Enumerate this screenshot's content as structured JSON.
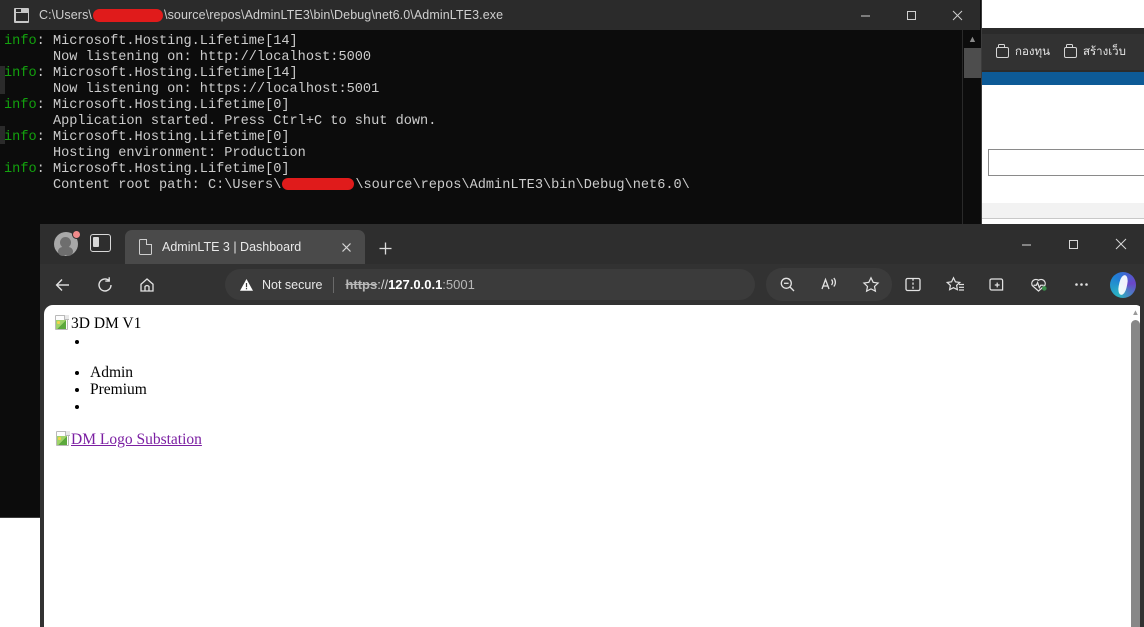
{
  "background_window": {
    "name": "background-browser-window",
    "bookmarks": [
      {
        "label": "กองทุน",
        "icon": "folder-icon"
      },
      {
        "label": "สร้างเว็บ",
        "icon": "folder-icon"
      }
    ],
    "accent_color": "#0d5a96"
  },
  "console": {
    "title_prefix": "C:\\Users\\",
    "title_suffix": "\\source\\repos\\AdminLTE3\\bin\\Debug\\net6.0\\AdminLTE3.exe",
    "icon": "console-window-icon",
    "window_buttons": {
      "minimize": "minimize-icon",
      "maximize": "maximize-icon",
      "close": "close-icon"
    },
    "lines": [
      {
        "level": "info",
        "sep": ": ",
        "text": "Microsoft.Hosting.Lifetime[14]"
      },
      {
        "level": "",
        "sep": "",
        "text": "      Now listening on: http://localhost:5000"
      },
      {
        "level": "info",
        "sep": ": ",
        "text": "Microsoft.Hosting.Lifetime[14]"
      },
      {
        "level": "",
        "sep": "",
        "text": "      Now listening on: https://localhost:5001"
      },
      {
        "level": "info",
        "sep": ": ",
        "text": "Microsoft.Hosting.Lifetime[0]"
      },
      {
        "level": "",
        "sep": "",
        "text": "      Application started. Press Ctrl+C to shut down."
      },
      {
        "level": "info",
        "sep": ": ",
        "text": "Microsoft.Hosting.Lifetime[0]"
      },
      {
        "level": "",
        "sep": "",
        "text": "      Hosting environment: Production"
      },
      {
        "level": "info",
        "sep": ": ",
        "text": "Microsoft.Hosting.Lifetime[0]"
      }
    ],
    "last_line": {
      "prefix": "      Content root path: C:\\Users\\",
      "suffix": "\\source\\repos\\AdminLTE3\\bin\\Debug\\net6.0\\"
    },
    "level_color": "#13a10e"
  },
  "browser": {
    "profile": {
      "name": "profile-avatar",
      "badge": "notification-dot"
    },
    "tab_actions_icon": "tab-actions-pane-icon",
    "tab": {
      "title": "AdminLTE 3 | Dashboard",
      "favicon": "page-favicon",
      "close": "close-tab-icon"
    },
    "new_tab_label": "+",
    "window_buttons": {
      "minimize": "minimize-icon",
      "maximize": "maximize-icon",
      "close": "close-icon"
    },
    "nav": {
      "back": "back-arrow-icon",
      "refresh": "refresh-icon",
      "home": "home-icon"
    },
    "omnibox": {
      "security_icon": "warning-triangle-icon",
      "security_label": "Not secure",
      "scheme": "https",
      "slashes": "://",
      "host": "127.0.0.1",
      "port": ":5001"
    },
    "toolbar_right": [
      {
        "name": "zoom-out-icon",
        "label": ""
      },
      {
        "name": "read-aloud-icon",
        "label": ""
      },
      {
        "name": "favorite-star-icon",
        "label": ""
      },
      {
        "name": "split-screen-icon",
        "label": ""
      },
      {
        "name": "favorites-list-icon",
        "label": ""
      },
      {
        "name": "add-to-collections-icon",
        "label": ""
      },
      {
        "name": "browser-essentials-icon",
        "label": ""
      },
      {
        "name": "more-options-icon",
        "label": "…"
      },
      {
        "name": "copilot-icon",
        "label": ""
      }
    ]
  },
  "page": {
    "heading_alt": "3D DM V1",
    "list_items": [
      "",
      "",
      "Admin",
      "Premium",
      ""
    ],
    "logo_link_alt": "DM Logo Substation",
    "link_color": "#7b1fa2",
    "scrollbar": {
      "arrow": "scroll-up-arrow-icon",
      "thumb": "scrollbar-thumb"
    }
  }
}
